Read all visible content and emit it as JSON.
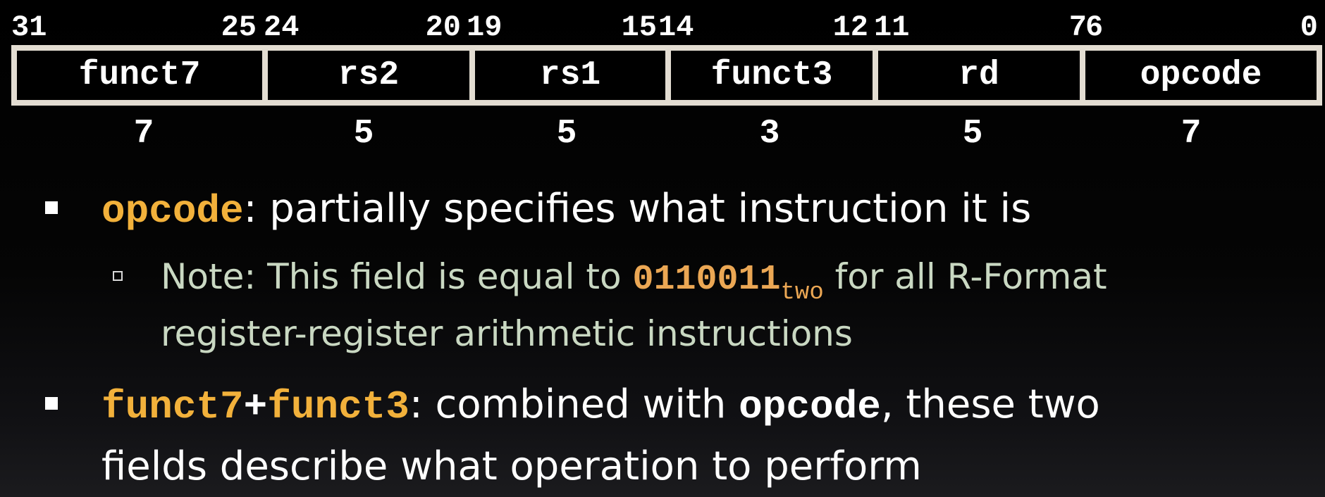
{
  "diagram": {
    "bits": {
      "f7_hi": "31",
      "f7_lo": "25",
      "rs2_hi": "24",
      "rs2_lo": "20",
      "rs1_hi": "19",
      "rs1_lo": "15",
      "f3_hi": "14",
      "f3_lo": "12",
      "rd_hi": "11",
      "rd_lo": "7",
      "op_hi": "6",
      "op_lo": "0"
    },
    "fields": [
      "funct7",
      "rs2",
      "rs1",
      "funct3",
      "rd",
      "opcode"
    ],
    "widths": [
      "7",
      "5",
      "5",
      "3",
      "5",
      "7"
    ]
  },
  "bullets": [
    {
      "keyword": "opcode",
      "text": ": partially specifies what instruction it is",
      "sub": {
        "prefix": "Note: This field is equal to ",
        "value": "0110011",
        "subscript": "two",
        "suffix": " for all R-Format",
        "line2": "register-register arithmetic instructions"
      }
    },
    {
      "keyword1": "funct7",
      "plus": "+",
      "keyword2": "funct3",
      "text1": ": combined with ",
      "keyword3": "opcode",
      "text2": ", these two",
      "line2": "fields describe what operation to perform"
    }
  ],
  "colors": {
    "keyword": "#f2b13b",
    "value": "#eba754",
    "subtext": "#c9d8c2",
    "frame": "#e3ddd2"
  }
}
